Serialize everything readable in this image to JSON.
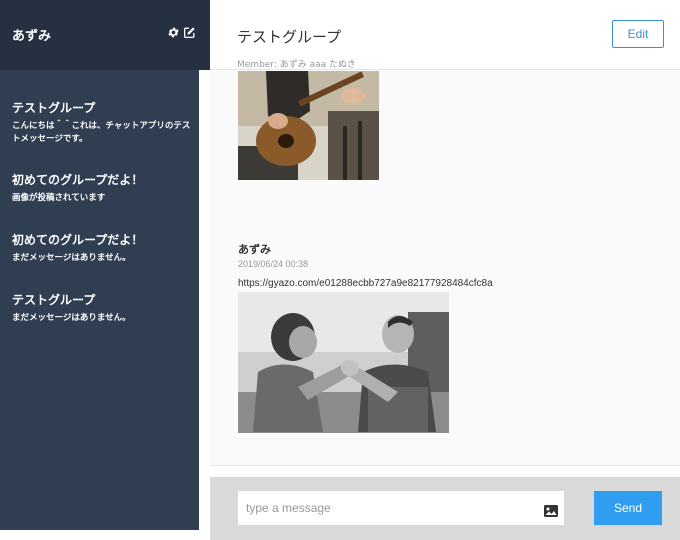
{
  "user": {
    "name": "あずみ"
  },
  "sidebar": {
    "groups": [
      {
        "name": "テストグループ",
        "last_message": "こんにちは＾＾これは、チャットアプリのテストメッセージです。"
      },
      {
        "name": "初めてのグループだよ！",
        "last_message": "画像が投稿されています"
      },
      {
        "name": "初めてのグループだよ！",
        "last_message": "まだメッセージはありません。"
      },
      {
        "name": "テストグループ",
        "last_message": "まだメッセージはありません。"
      }
    ]
  },
  "header": {
    "group_name": "テストグループ",
    "members": "Member: あずみ aaa たぬき",
    "edit_label": "Edit"
  },
  "messages": [
    {
      "image_desc": "guitar-photo"
    },
    {
      "author": "あずみ",
      "time": "2019/06/24 00:38",
      "text": "https://gyazo.com/e01288ecbb727a9e82177928484cfc8a",
      "image_desc": "arm-wrestling-photo"
    }
  ],
  "footer": {
    "input_placeholder": "type a message",
    "send_label": "Send"
  },
  "colors": {
    "sidebar_header": "#253141",
    "sidebar_body": "#2f3e51",
    "accent": "#2f9ef0",
    "edit_border": "#3a8fd6"
  }
}
